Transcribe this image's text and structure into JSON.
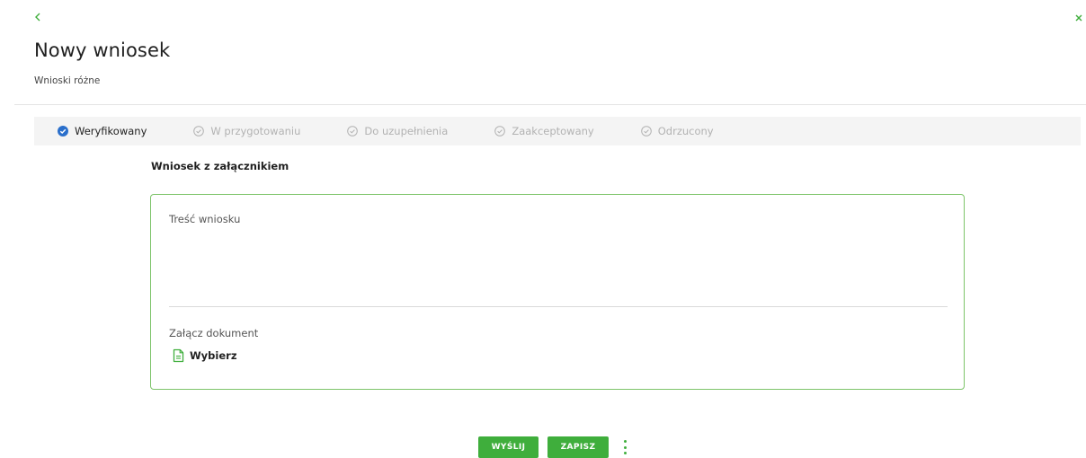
{
  "colors": {
    "accent": "#3fae3c",
    "border_green": "#7dc46a",
    "active_step_icon": "#2a6fcb",
    "inactive_step": "#b2b2b2",
    "status_bar_bg": "#f4f4f4"
  },
  "header": {
    "back_icon": "chevron-left-icon",
    "close_icon": "close-icon",
    "title": "Nowy wniosek",
    "subtitle": "Wnioski różne"
  },
  "status_steps": [
    {
      "label": "Weryfikowany",
      "active": true,
      "icon": "check-circle-filled-icon"
    },
    {
      "label": "W przygotowaniu",
      "active": false,
      "icon": "check-circle-outline-icon"
    },
    {
      "label": "Do uzupełnienia",
      "active": false,
      "icon": "check-circle-outline-icon"
    },
    {
      "label": "Zaakceptowany",
      "active": false,
      "icon": "check-circle-outline-icon"
    },
    {
      "label": "Odrzucony",
      "active": false,
      "icon": "check-circle-outline-icon"
    }
  ],
  "form": {
    "section_title": "Wniosek z załącznikiem",
    "content_placeholder": "Treść wniosku",
    "content_value": "",
    "attach_label": "Załącz dokument",
    "choose_label": "Wybierz",
    "choose_icon": "document-icon"
  },
  "actions": {
    "send_label": "WYŚLIJ",
    "save_label": "ZAPISZ",
    "more_icon": "more-vertical-icon"
  }
}
